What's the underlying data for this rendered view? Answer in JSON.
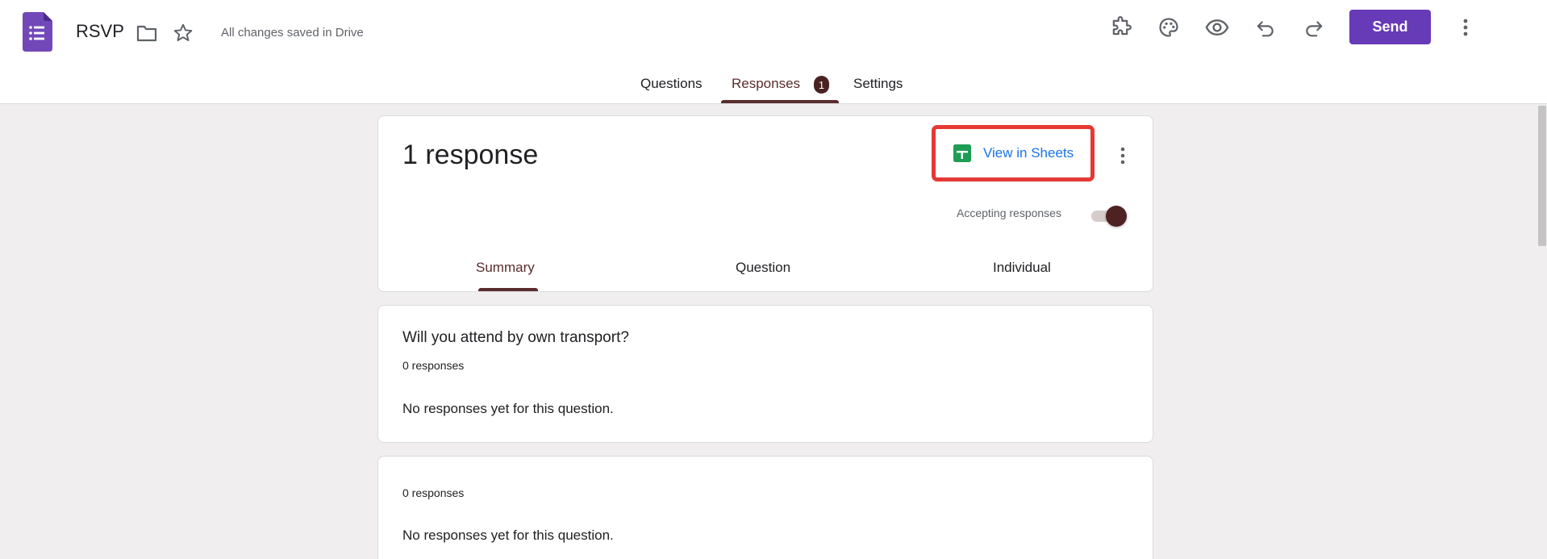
{
  "header": {
    "title": "RSVP",
    "save_status": "All changes saved in Drive",
    "send_label": "Send",
    "colors": {
      "brand": "#673ab7",
      "accent": "#5b2c2c"
    },
    "icons": [
      "forms-logo-icon",
      "folder-icon",
      "star-icon",
      "addons-icon",
      "palette-icon",
      "preview-eye-icon",
      "undo-icon",
      "redo-icon",
      "more-vert-icon"
    ]
  },
  "tabs": [
    {
      "label": "Questions"
    },
    {
      "label": "Responses",
      "badge": "1",
      "active": true
    },
    {
      "label": "Settings"
    }
  ],
  "summary": {
    "response_count": "1 response",
    "view_sheets_label": "View in Sheets",
    "accepting_label": "Accepting responses",
    "accepting_on": true,
    "sub_tabs": [
      {
        "label": "Summary",
        "active": true
      },
      {
        "label": "Question"
      },
      {
        "label": "Individual"
      }
    ]
  },
  "questions": [
    {
      "title": "Will you attend by own transport?",
      "count": "0 responses",
      "empty": "No responses yet for this question."
    },
    {
      "title": "",
      "count": "0 responses",
      "empty": "No responses yet for this question."
    }
  ]
}
